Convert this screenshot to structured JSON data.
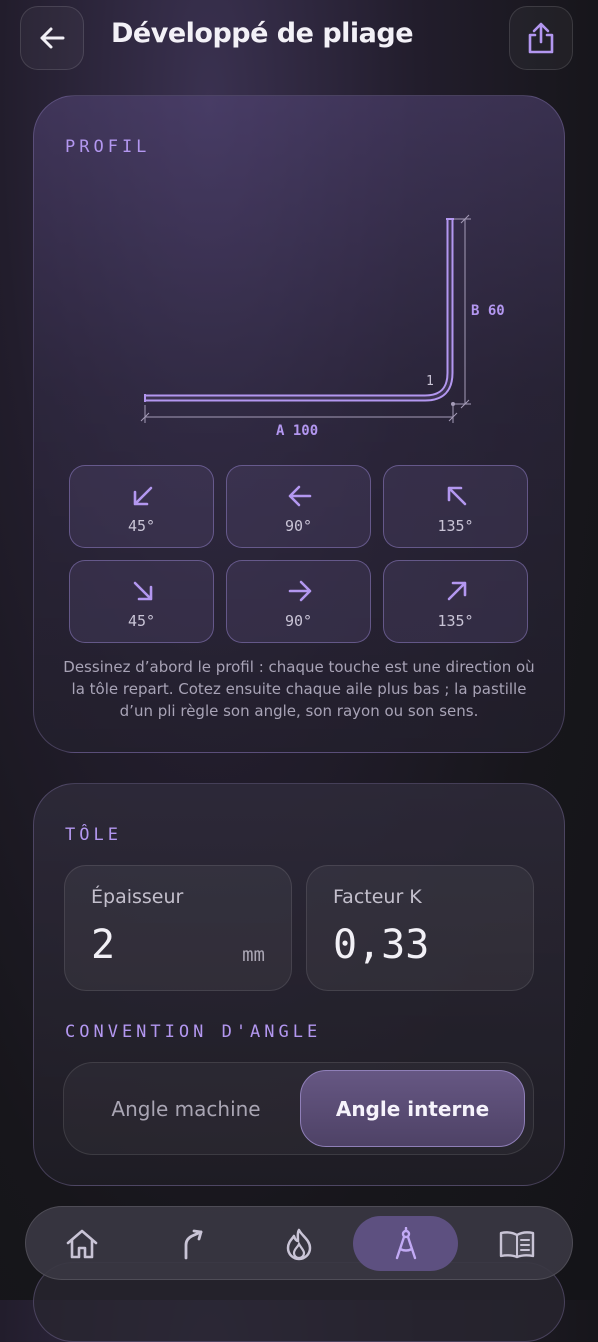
{
  "header": {
    "title": "Développé de pliage"
  },
  "profil": {
    "label": "PROFIL",
    "dim_a": "A 100",
    "dim_b": "B 60",
    "bend_number": "1",
    "directions": [
      {
        "icon": "arrow-down-left-icon",
        "angle": "45°"
      },
      {
        "icon": "arrow-left-icon",
        "angle": "90°"
      },
      {
        "icon": "arrow-up-left-icon",
        "angle": "135°"
      },
      {
        "icon": "arrow-down-right-icon",
        "angle": "45°"
      },
      {
        "icon": "arrow-right-icon",
        "angle": "90°"
      },
      {
        "icon": "arrow-up-right-icon",
        "angle": "135°"
      }
    ],
    "help": "Dessinez d’abord le profil : chaque touche est une direction où la tôle repart. Cotez ensuite chaque aile plus bas ; la pastille d’un pli règle son angle, son rayon ou son sens."
  },
  "tole": {
    "label": "TÔLE",
    "thickness": {
      "label": "Épaisseur",
      "value": "2",
      "unit": "mm"
    },
    "kfactor": {
      "label": "Facteur K",
      "value": "0,33"
    }
  },
  "convention": {
    "label": "CONVENTION D'ANGLE",
    "options": [
      "Angle machine",
      "Angle interne"
    ],
    "selected": "Angle interne"
  },
  "nav": {
    "items": [
      "home-icon",
      "bend-icon",
      "flame-icon",
      "compass-icon",
      "book-icon"
    ],
    "active": "compass-icon"
  },
  "colors": {
    "accent": "#b397f0",
    "active_nav": "#5d5080"
  }
}
